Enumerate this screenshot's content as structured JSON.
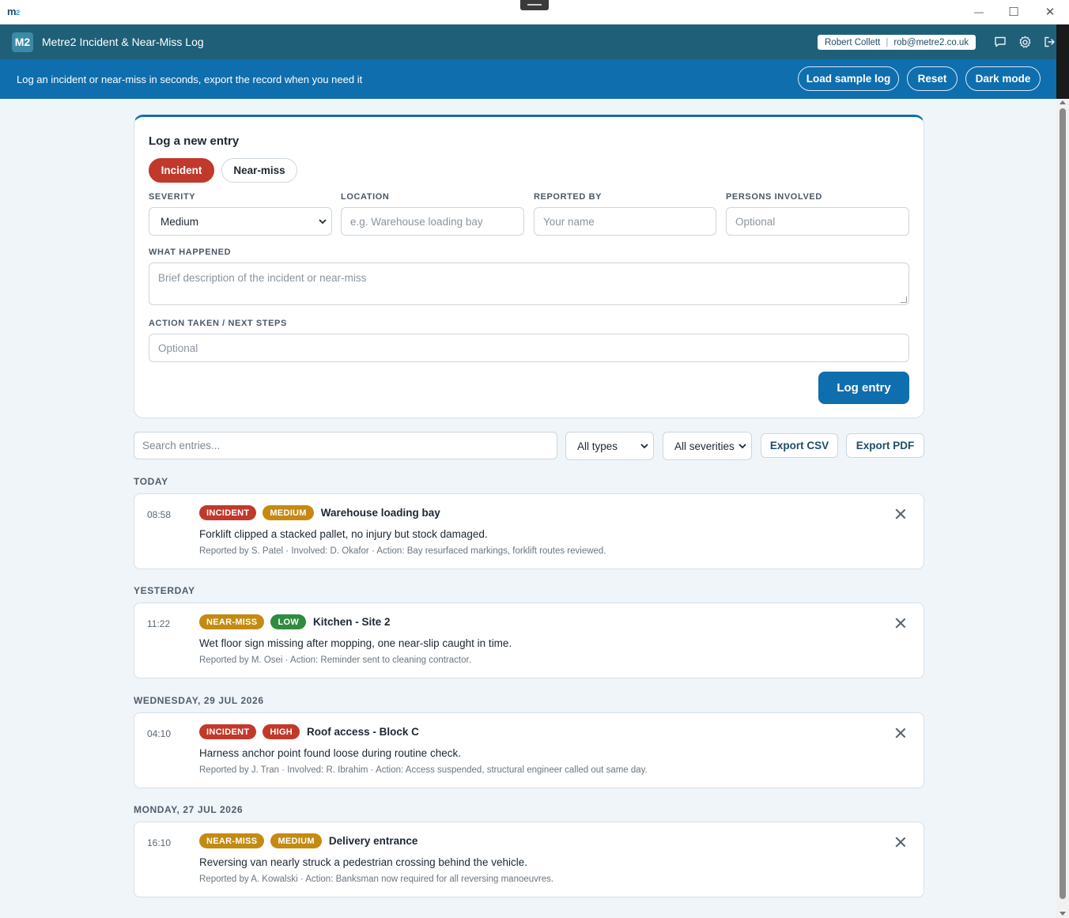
{
  "os": {
    "logo": "m",
    "logo_sub": "2",
    "minimize": "—",
    "maximize": "☐",
    "close": "✕"
  },
  "header": {
    "badge": "M2",
    "title": "Metre2 Incident & Near-Miss Log",
    "user_name": "Robert Collett",
    "user_email": "rob@metre2.co.uk"
  },
  "banner": {
    "text": "Log an incident or near-miss in seconds, export the record when you need it",
    "load_sample": "Load sample log",
    "reset": "Reset",
    "dark_mode": "Dark mode"
  },
  "form": {
    "title": "Log a new entry",
    "type_incident": "Incident",
    "type_near_miss": "Near-miss",
    "severity_label": "SEVERITY",
    "severity_value": "Medium",
    "location_label": "LOCATION",
    "location_placeholder": "e.g. Warehouse loading bay",
    "reported_label": "REPORTED BY",
    "reported_placeholder": "Your name",
    "persons_label": "PERSONS INVOLVED",
    "persons_placeholder": "Optional",
    "what_label": "WHAT HAPPENED",
    "what_placeholder": "Brief description of the incident or near-miss",
    "action_label": "ACTION TAKEN / NEXT STEPS",
    "action_placeholder": "Optional",
    "submit": "Log entry"
  },
  "filters": {
    "search_placeholder": "Search entries...",
    "type_value": "All types",
    "severity_value": "All severities",
    "export_csv": "Export CSV",
    "export_pdf": "Export PDF"
  },
  "colors": {
    "incident": "#c0392b",
    "near_miss": "#c48a12",
    "medium": "#c48a12",
    "low": "#2e8b3f",
    "high": "#c0392b",
    "accent": "#0f6eae"
  },
  "groups": [
    {
      "label": "TODAY",
      "entries": [
        {
          "time": "08:58",
          "type": "INCIDENT",
          "severity": "MEDIUM",
          "location": "Warehouse loading bay",
          "description": "Forklift clipped a stacked pallet, no injury but stock damaged.",
          "meta": "Reported by S. Patel · Involved: D. Okafor · Action: Bay resurfaced markings, forklift routes reviewed."
        }
      ]
    },
    {
      "label": "YESTERDAY",
      "entries": [
        {
          "time": "11:22",
          "type": "NEAR-MISS",
          "severity": "LOW",
          "location": "Kitchen - Site 2",
          "description": "Wet floor sign missing after mopping, one near-slip caught in time.",
          "meta": "Reported by M. Osei · Action: Reminder sent to cleaning contractor."
        }
      ]
    },
    {
      "label": "WEDNESDAY, 29 JUL 2026",
      "entries": [
        {
          "time": "04:10",
          "type": "INCIDENT",
          "severity": "HIGH",
          "location": "Roof access - Block C",
          "description": "Harness anchor point found loose during routine check.",
          "meta": "Reported by J. Tran · Involved: R. Ibrahim · Action: Access suspended, structural engineer called out same day."
        }
      ]
    },
    {
      "label": "MONDAY, 27 JUL 2026",
      "entries": [
        {
          "time": "16:10",
          "type": "NEAR-MISS",
          "severity": "MEDIUM",
          "location": "Delivery entrance",
          "description": "Reversing van nearly struck a pedestrian crossing behind the vehicle.",
          "meta": "Reported by A. Kowalski · Action: Banksman now required for all reversing manoeuvres."
        }
      ]
    }
  ]
}
